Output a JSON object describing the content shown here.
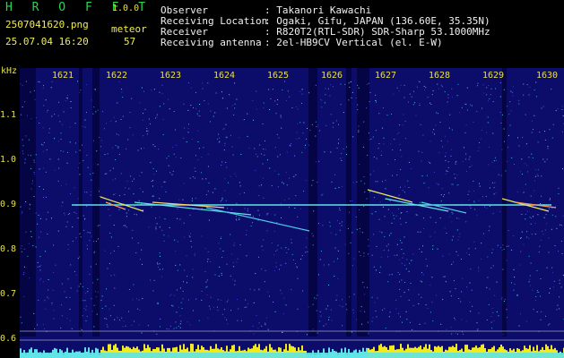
{
  "header": {
    "brand": "H R O F F T",
    "version": "1.0.0",
    "filename": "2507041620.png",
    "mode": "meteor",
    "datetime": "25.07.04 16:20",
    "count": "57",
    "info": [
      {
        "label": "Observer",
        "value": ": Takanori Kawachi"
      },
      {
        "label": "Receiving Location",
        "value": ": Ogaki, Gifu, JAPAN (136.60E, 35.35N)"
      },
      {
        "label": "Receiver",
        "value": ": R820T2(RTL-SDR) SDR-Sharp 53.1000MHz"
      },
      {
        "label": "Receiving antenna",
        "value": ": 2el-HB9CV Vertical (el. E-W)"
      }
    ]
  },
  "axes": {
    "y_unit": "kHz",
    "y_ticks": [
      "1.1",
      "1.0",
      "0.9",
      "0.8",
      "0.7",
      "0.6"
    ],
    "x_ticks": [
      "1621",
      "1622",
      "1623",
      "1624",
      "1625",
      "1626",
      "1627",
      "1628",
      "1629",
      "1630"
    ]
  },
  "colors": {
    "background": "#0c0c6a",
    "text_yellow": "#f2ee4a",
    "text_white": "#f0f0f0",
    "brand_green": "#27d84a",
    "signal_cyan": "#5fe4e6",
    "level_yellow": "#f3ea1c"
  }
}
